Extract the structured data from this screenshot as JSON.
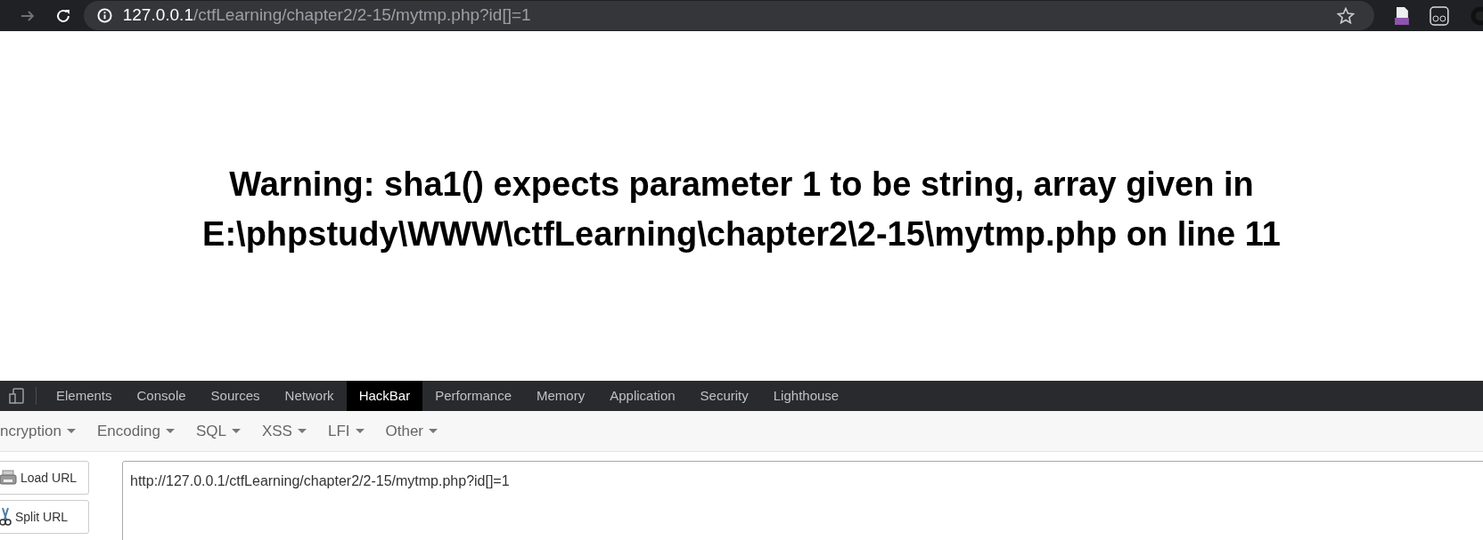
{
  "browser": {
    "address_host": "127.0.0.1",
    "address_path": "/ctfLearning/chapter2/2-15/mytmp.php?id[]=1"
  },
  "page": {
    "warning": "Warning: sha1() expects parameter 1 to be string, array given in E:\\phpstudy\\WWW\\ctfLearning\\chapter2\\2-15\\mytmp.php on line 11"
  },
  "devtools": {
    "tabs": [
      {
        "label": "Elements",
        "selected": false
      },
      {
        "label": "Console",
        "selected": false
      },
      {
        "label": "Sources",
        "selected": false
      },
      {
        "label": "Network",
        "selected": false
      },
      {
        "label": "HackBar",
        "selected": true
      },
      {
        "label": "Performance",
        "selected": false
      },
      {
        "label": "Memory",
        "selected": false
      },
      {
        "label": "Application",
        "selected": false
      },
      {
        "label": "Security",
        "selected": false
      },
      {
        "label": "Lighthouse",
        "selected": false
      }
    ]
  },
  "hackbar": {
    "menus": [
      "ncryption",
      "Encoding",
      "SQL",
      "XSS",
      "LFI",
      "Other"
    ],
    "buttons": [
      {
        "kind": "load",
        "label": "Load URL"
      },
      {
        "kind": "split",
        "label": "Split URL"
      }
    ],
    "url_value": "http://127.0.0.1/ctfLearning/chapter2/2-15/mytmp.php?id[]=1"
  }
}
